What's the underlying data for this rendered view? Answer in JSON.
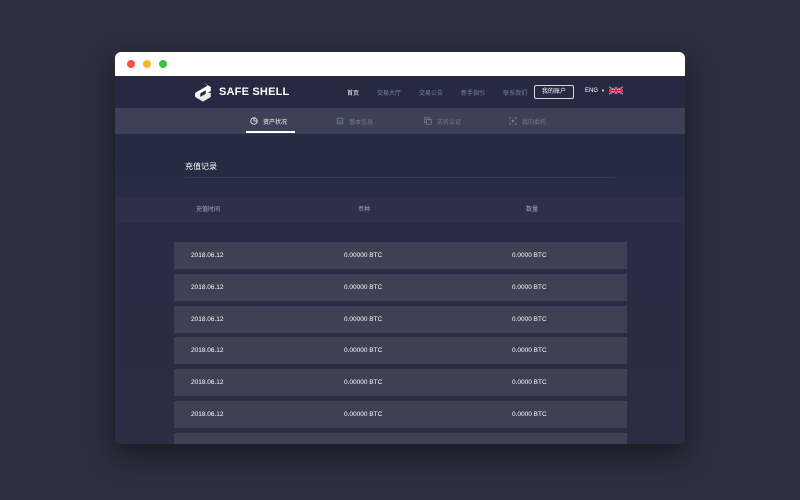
{
  "brand": {
    "name": "SAFE SHELL"
  },
  "nav": {
    "items": [
      {
        "label": "首页",
        "active": true
      },
      {
        "label": "交易大厅",
        "active": false
      },
      {
        "label": "交易公告",
        "active": false
      },
      {
        "label": "新手指引",
        "active": false
      },
      {
        "label": "联系我们",
        "active": false
      }
    ],
    "account_button": "我的账户",
    "language": "ENG",
    "flag_icon": "uk-flag-icon"
  },
  "subnav": {
    "tabs": [
      {
        "label": "资产状况",
        "icon": "pie-chart-icon",
        "active": true
      },
      {
        "label": "基本信息",
        "icon": "id-card-icon",
        "active": false
      },
      {
        "label": "实名认证",
        "icon": "copy-icon",
        "active": false
      },
      {
        "label": "我的委托",
        "icon": "frame-icon",
        "active": false
      }
    ]
  },
  "section": {
    "title": "充值记录"
  },
  "table": {
    "headers": [
      "充值时间",
      "币种",
      "数量"
    ],
    "rows": [
      [
        "2018.06.12",
        "0.00000 BTC",
        "0.0000 BTC"
      ],
      [
        "2018.06.12",
        "0.00000 BTC",
        "0.0000 BTC"
      ],
      [
        "2018.06.12",
        "0.00000 BTC",
        "0.0000 BTC"
      ],
      [
        "2018.06.12",
        "0.00000 BTC",
        "0.0000 BTC"
      ],
      [
        "2018.06.12",
        "0.00000 BTC",
        "0.0000 BTC"
      ],
      [
        "2018.06.12",
        "0.00000 BTC",
        "0.0000 BTC"
      ],
      [
        "",
        "",
        ""
      ]
    ]
  },
  "colors": {
    "page_background": "#2b2f3e",
    "nav_background": "#252a42",
    "subnav_background": "#3d4157",
    "row_background": "#3e4053",
    "text_primary": "#ffffff",
    "text_muted": "#7d8299"
  }
}
